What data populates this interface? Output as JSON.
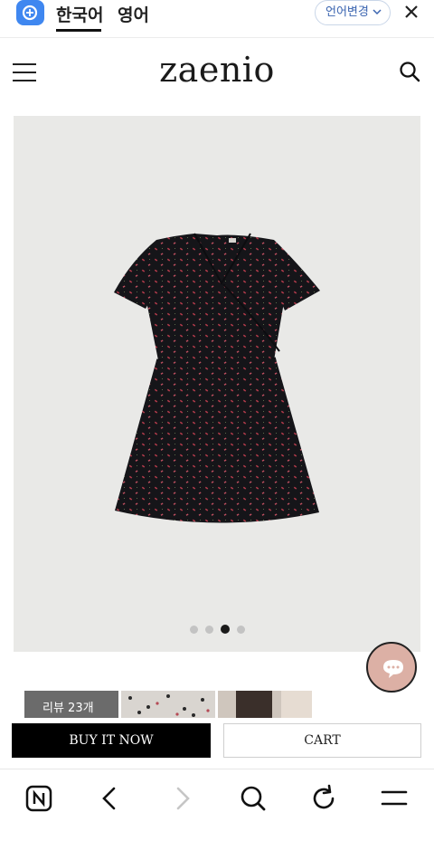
{
  "translate_bar": {
    "languages": [
      "한국어",
      "영어"
    ],
    "change_language_label": "언어변경"
  },
  "header": {
    "logo_text": "zaenio"
  },
  "gallery": {
    "slide_count": 4,
    "active_index": 2
  },
  "reviews": {
    "count_label": "리뷰 23개"
  },
  "actions": {
    "buy_label": "BUY IT NOW",
    "cart_label": "CART"
  },
  "browser_nav": {
    "icons": [
      "naver-home-icon",
      "back-icon",
      "forward-icon",
      "search-icon",
      "refresh-icon",
      "menu-icon"
    ]
  },
  "colors": {
    "chat_bubble": "#dcb0a5",
    "buy_button": "#000000",
    "translator_accent": "#3f87f0"
  }
}
